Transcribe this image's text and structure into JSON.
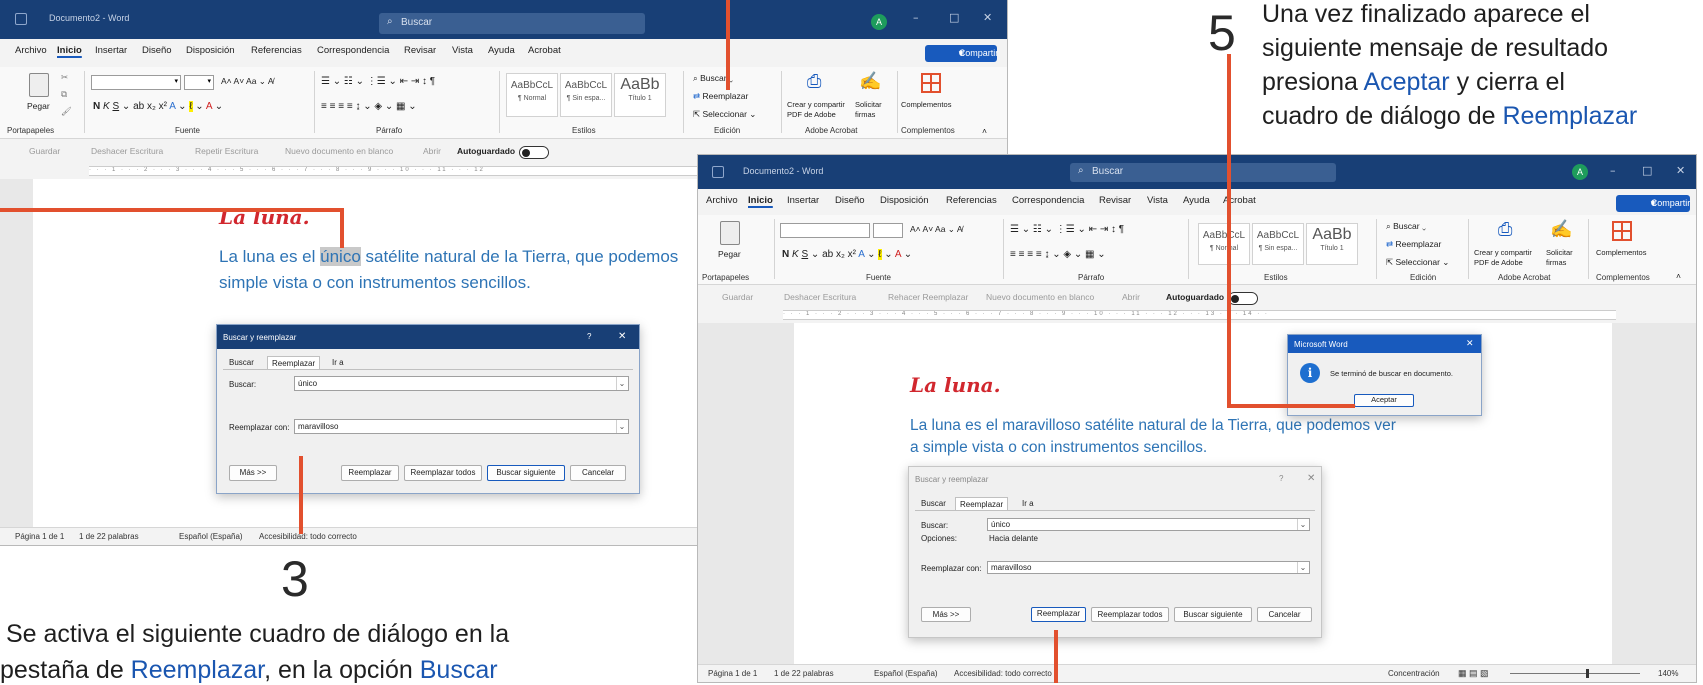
{
  "window1": {
    "title": "Documento2 - Word",
    "search_placeholder": "Buscar",
    "avatar": "A",
    "menu": [
      "Archivo",
      "Inicio",
      "Insertar",
      "Diseño",
      "Disposición",
      "Referencias",
      "Correspondencia",
      "Revisar",
      "Vista",
      "Ayuda",
      "Acrobat"
    ],
    "share_label": "Compartir",
    "ribbon": {
      "paste": "Pegar",
      "clipboard_group": "Portapapeles",
      "font_group": "Fuente",
      "paragraph_group": "Párrafo",
      "styles_group": "Estilos",
      "edit_group": "Edición",
      "acrobat_group": "Adobe Acrobat",
      "addins_group": "Complementos",
      "styles": [
        {
          "sample": "AaBbCcL",
          "name": "¶ Normal"
        },
        {
          "sample": "AaBbCcL",
          "name": "¶ Sin espa..."
        },
        {
          "sample": "AaBb",
          "name": "Título 1"
        }
      ],
      "find": "Buscar",
      "replace": "Reemplazar",
      "select": "Seleccionar",
      "create_pdf": "Crear y compartir PDF de Adobe",
      "request_sign": "Solicitar firmas",
      "addins": "Complementos"
    },
    "qat": [
      "Guardar",
      "Deshacer Escritura",
      "Repetir Escritura",
      "Nuevo documento en blanco",
      "Abrir",
      "Autoguardado"
    ],
    "doc_title": "La luna.",
    "doc_line1_pre": "La luna es el ",
    "doc_line1_highlight": "único",
    "doc_line1_post": " satélite natural de la Tierra, que podemos",
    "doc_line2": "simple vista o con instrumentos sencillos.",
    "status": [
      "Página 1 de 1",
      "1 de 22 palabras",
      "Español (España)",
      "Accesibilidad: todo correcto"
    ],
    "dialog": {
      "title": "Buscar y reemplazar",
      "help": "?",
      "tabs": [
        "Buscar",
        "Reemplazar",
        "Ir a"
      ],
      "find_label": "Buscar:",
      "find_value": "único",
      "replace_label": "Reemplazar con:",
      "replace_value": "maravilloso",
      "more": "Más >>",
      "btn_replace": "Reemplazar",
      "btn_replace_all": "Reemplazar todos",
      "btn_find_next": "Buscar siguiente",
      "btn_cancel": "Cancelar"
    }
  },
  "window2": {
    "title": "Documento2 - Word",
    "search_placeholder": "Buscar",
    "avatar": "A",
    "menu": [
      "Archivo",
      "Inicio",
      "Insertar",
      "Diseño",
      "Disposición",
      "Referencias",
      "Correspondencia",
      "Revisar",
      "Vista",
      "Ayuda",
      "Acrobat"
    ],
    "share_label": "Compartir",
    "qat": [
      "Guardar",
      "Deshacer Escritura",
      "Rehacer Reemplazar",
      "Nuevo documento en blanco",
      "Abrir",
      "Autoguardado"
    ],
    "doc_title": "La luna.",
    "doc_line1": "La luna es el maravilloso satélite natural de la Tierra, que podemos ver",
    "doc_line2": "a simple vista o con instrumentos sencillos.",
    "msgbox": {
      "title": "Microsoft Word",
      "message": "Se terminó de buscar en documento.",
      "ok": "Aceptar"
    },
    "dialog": {
      "title": "Buscar y reemplazar",
      "help": "?",
      "tabs": [
        "Buscar",
        "Reemplazar",
        "Ir a"
      ],
      "find_label": "Buscar:",
      "find_value": "único",
      "options_label": "Opciones:",
      "options_value": "Hacia delante",
      "replace_label": "Reemplazar con:",
      "replace_value": "maravilloso",
      "more": "Más >>",
      "btn_replace": "Reemplazar",
      "btn_replace_all": "Reemplazar todos",
      "btn_find_next": "Buscar siguiente",
      "btn_cancel": "Cancelar"
    },
    "status": [
      "Página 1 de 1",
      "1 de 22 palabras",
      "Español (España)",
      "Accesibilidad: todo correcto",
      "Concentración",
      "140%"
    ]
  },
  "annotations": {
    "step3_number": "3",
    "step3_line1": "Se activa el siguiente cuadro de diálogo en la",
    "step3_line2_pre": "pestaña de ",
    "step3_line2_kw1": "Reemplazar",
    "step3_line2_mid": ", en la opción ",
    "step3_line2_kw2": "Buscar",
    "step5_number": "5",
    "step5_line1": "Una vez finalizado aparece el",
    "step5_line2": "siguiente mensaje de resultado",
    "step5_line3_pre": "presiona ",
    "step5_line3_kw": "Aceptar",
    "step5_line3_post": " y cierra el",
    "step5_line4_pre": "cuadro de diálogo de ",
    "step5_line4_kw": "Reemplazar"
  },
  "colors": {
    "titlebar": "#183f76",
    "accent": "#185abd",
    "doc_title": "#d1272e",
    "doc_text": "#2e74b5",
    "annotation_line": "#e2502e",
    "keyword": "#1a56b0"
  }
}
